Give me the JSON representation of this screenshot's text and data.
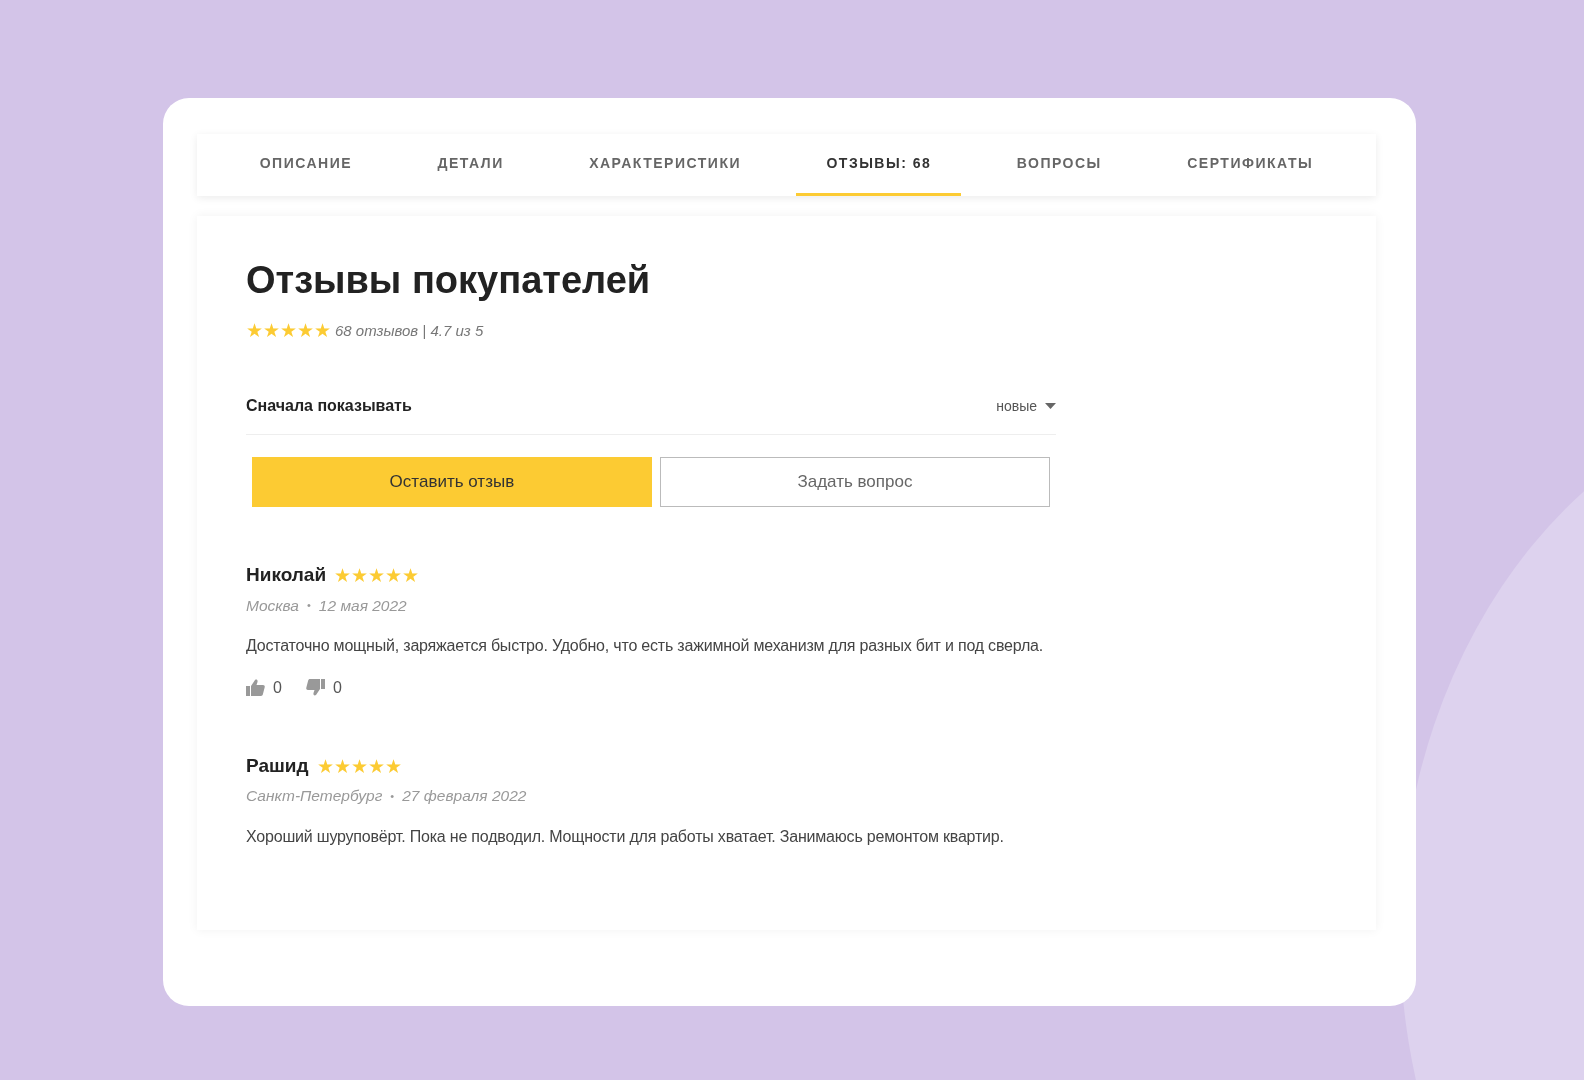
{
  "tabs": [
    {
      "label": "ОПИСАНИЕ",
      "selected": false
    },
    {
      "label": "ДЕТАЛИ",
      "selected": false
    },
    {
      "label": "ХАРАКТЕРИСТИКИ",
      "selected": false
    },
    {
      "label": "ОТЗЫВЫ: 68",
      "selected": true
    },
    {
      "label": "ВОПРОСЫ",
      "selected": false
    },
    {
      "label": "СЕРТИФИКАТЫ",
      "selected": false
    }
  ],
  "heading": "Отзывы покупателей",
  "summary": {
    "stars": 5,
    "text": "68 отзывов | 4.7 из 5"
  },
  "sort": {
    "label": "Сначала показывать",
    "value": "новые"
  },
  "buttons": [
    {
      "label": "Оставить отзыв",
      "kind": "primary"
    },
    {
      "label": "Задать вопрос",
      "kind": "outline"
    }
  ],
  "reviews": [
    {
      "author": "Николай",
      "stars": 5,
      "city": "Москва",
      "separator": "•",
      "date": "12 мая 2022",
      "text": "Достаточно мощный, заряжается быстро. Удобно, что есть зажимной механизм для разных бит и под сверла.",
      "likes": "0",
      "dislikes": "0"
    },
    {
      "author": "Рашид",
      "stars": 5,
      "city": "Санкт-Петербург",
      "separator": "•",
      "date": "27 февраля 2022",
      "text": "Хороший шуруповёрт. Пока не подводил. Мощности для работы хватает. Занимаюсь ремонтом квартир."
    }
  ]
}
